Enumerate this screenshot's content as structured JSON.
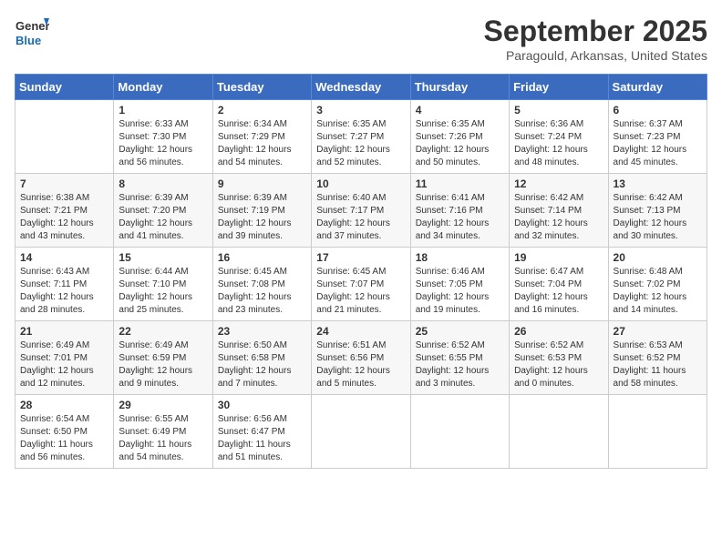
{
  "logo": {
    "line1": "General",
    "line2": "Blue"
  },
  "title": "September 2025",
  "location": "Paragould, Arkansas, United States",
  "weekdays": [
    "Sunday",
    "Monday",
    "Tuesday",
    "Wednesday",
    "Thursday",
    "Friday",
    "Saturday"
  ],
  "weeks": [
    [
      {
        "day": "",
        "info": ""
      },
      {
        "day": "1",
        "info": "Sunrise: 6:33 AM\nSunset: 7:30 PM\nDaylight: 12 hours\nand 56 minutes."
      },
      {
        "day": "2",
        "info": "Sunrise: 6:34 AM\nSunset: 7:29 PM\nDaylight: 12 hours\nand 54 minutes."
      },
      {
        "day": "3",
        "info": "Sunrise: 6:35 AM\nSunset: 7:27 PM\nDaylight: 12 hours\nand 52 minutes."
      },
      {
        "day": "4",
        "info": "Sunrise: 6:35 AM\nSunset: 7:26 PM\nDaylight: 12 hours\nand 50 minutes."
      },
      {
        "day": "5",
        "info": "Sunrise: 6:36 AM\nSunset: 7:24 PM\nDaylight: 12 hours\nand 48 minutes."
      },
      {
        "day": "6",
        "info": "Sunrise: 6:37 AM\nSunset: 7:23 PM\nDaylight: 12 hours\nand 45 minutes."
      }
    ],
    [
      {
        "day": "7",
        "info": "Sunrise: 6:38 AM\nSunset: 7:21 PM\nDaylight: 12 hours\nand 43 minutes."
      },
      {
        "day": "8",
        "info": "Sunrise: 6:39 AM\nSunset: 7:20 PM\nDaylight: 12 hours\nand 41 minutes."
      },
      {
        "day": "9",
        "info": "Sunrise: 6:39 AM\nSunset: 7:19 PM\nDaylight: 12 hours\nand 39 minutes."
      },
      {
        "day": "10",
        "info": "Sunrise: 6:40 AM\nSunset: 7:17 PM\nDaylight: 12 hours\nand 37 minutes."
      },
      {
        "day": "11",
        "info": "Sunrise: 6:41 AM\nSunset: 7:16 PM\nDaylight: 12 hours\nand 34 minutes."
      },
      {
        "day": "12",
        "info": "Sunrise: 6:42 AM\nSunset: 7:14 PM\nDaylight: 12 hours\nand 32 minutes."
      },
      {
        "day": "13",
        "info": "Sunrise: 6:42 AM\nSunset: 7:13 PM\nDaylight: 12 hours\nand 30 minutes."
      }
    ],
    [
      {
        "day": "14",
        "info": "Sunrise: 6:43 AM\nSunset: 7:11 PM\nDaylight: 12 hours\nand 28 minutes."
      },
      {
        "day": "15",
        "info": "Sunrise: 6:44 AM\nSunset: 7:10 PM\nDaylight: 12 hours\nand 25 minutes."
      },
      {
        "day": "16",
        "info": "Sunrise: 6:45 AM\nSunset: 7:08 PM\nDaylight: 12 hours\nand 23 minutes."
      },
      {
        "day": "17",
        "info": "Sunrise: 6:45 AM\nSunset: 7:07 PM\nDaylight: 12 hours\nand 21 minutes."
      },
      {
        "day": "18",
        "info": "Sunrise: 6:46 AM\nSunset: 7:05 PM\nDaylight: 12 hours\nand 19 minutes."
      },
      {
        "day": "19",
        "info": "Sunrise: 6:47 AM\nSunset: 7:04 PM\nDaylight: 12 hours\nand 16 minutes."
      },
      {
        "day": "20",
        "info": "Sunrise: 6:48 AM\nSunset: 7:02 PM\nDaylight: 12 hours\nand 14 minutes."
      }
    ],
    [
      {
        "day": "21",
        "info": "Sunrise: 6:49 AM\nSunset: 7:01 PM\nDaylight: 12 hours\nand 12 minutes."
      },
      {
        "day": "22",
        "info": "Sunrise: 6:49 AM\nSunset: 6:59 PM\nDaylight: 12 hours\nand 9 minutes."
      },
      {
        "day": "23",
        "info": "Sunrise: 6:50 AM\nSunset: 6:58 PM\nDaylight: 12 hours\nand 7 minutes."
      },
      {
        "day": "24",
        "info": "Sunrise: 6:51 AM\nSunset: 6:56 PM\nDaylight: 12 hours\nand 5 minutes."
      },
      {
        "day": "25",
        "info": "Sunrise: 6:52 AM\nSunset: 6:55 PM\nDaylight: 12 hours\nand 3 minutes."
      },
      {
        "day": "26",
        "info": "Sunrise: 6:52 AM\nSunset: 6:53 PM\nDaylight: 12 hours\nand 0 minutes."
      },
      {
        "day": "27",
        "info": "Sunrise: 6:53 AM\nSunset: 6:52 PM\nDaylight: 11 hours\nand 58 minutes."
      }
    ],
    [
      {
        "day": "28",
        "info": "Sunrise: 6:54 AM\nSunset: 6:50 PM\nDaylight: 11 hours\nand 56 minutes."
      },
      {
        "day": "29",
        "info": "Sunrise: 6:55 AM\nSunset: 6:49 PM\nDaylight: 11 hours\nand 54 minutes."
      },
      {
        "day": "30",
        "info": "Sunrise: 6:56 AM\nSunset: 6:47 PM\nDaylight: 11 hours\nand 51 minutes."
      },
      {
        "day": "",
        "info": ""
      },
      {
        "day": "",
        "info": ""
      },
      {
        "day": "",
        "info": ""
      },
      {
        "day": "",
        "info": ""
      }
    ]
  ]
}
